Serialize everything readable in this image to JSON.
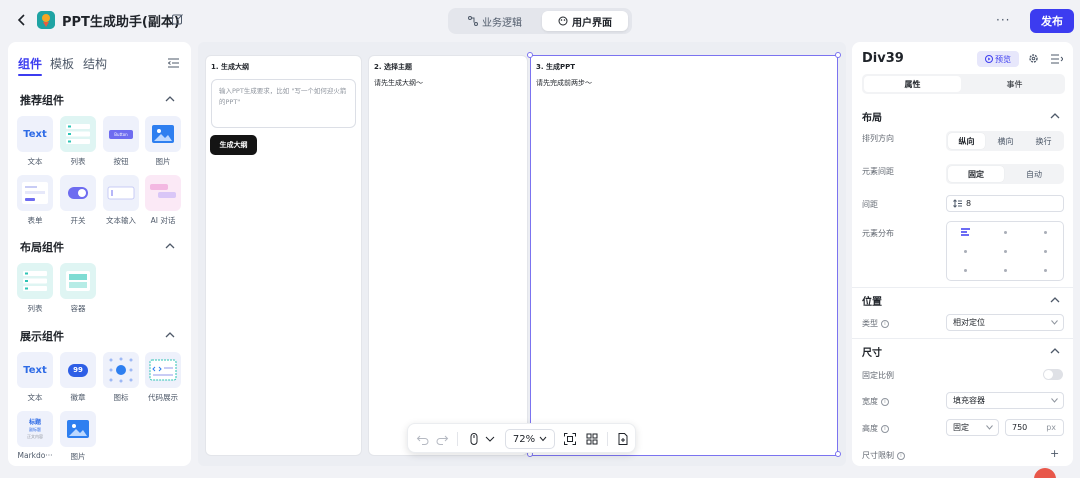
{
  "header": {
    "app_title": "PPT生成助手(副本)",
    "tabs": [
      {
        "label": "业务逻辑"
      },
      {
        "label": "用户界面"
      }
    ],
    "more": "···",
    "publish": "发布"
  },
  "left_panel": {
    "tabs": [
      "组件",
      "模板",
      "结构"
    ],
    "sections": [
      {
        "title": "推荐组件",
        "items": [
          "文本",
          "列表",
          "按钮",
          "图片",
          "表单",
          "开关",
          "文本输入",
          "AI 对话"
        ]
      },
      {
        "title": "布局组件",
        "items": [
          "列表",
          "容器"
        ]
      },
      {
        "title": "展示组件",
        "items": [
          "文本",
          "徽章",
          "图标",
          "代码展示",
          "Markdo···",
          "图片"
        ]
      }
    ],
    "tile_text": "Text",
    "badge_num": "99",
    "md_tile": [
      "标题",
      "副标题",
      "正文内容"
    ],
    "button_tile_text": "Button"
  },
  "canvas": {
    "col1": {
      "title": "1. 生成大纲",
      "placeholder": "输入PPT生成要求，比如 \"写一个如何迎火箭的PPT\"",
      "button": "生成大纲"
    },
    "col2": {
      "title": "2. 选择主题",
      "hint": "请先生成大纲～"
    },
    "col3": {
      "title": "3. 生成PPT",
      "hint": "请先完成前两步～"
    }
  },
  "toolbar": {
    "zoom": "72%"
  },
  "right_panel": {
    "title": "Div39",
    "preview": "预览",
    "tabs": [
      "属性",
      "事件"
    ],
    "layout": {
      "title": "布局",
      "direction_label": "排列方向",
      "direction_options": [
        "纵向",
        "横向",
        "换行"
      ],
      "spacing_label": "元素间距",
      "spacing_options": [
        "固定",
        "自动"
      ],
      "gap_label": "间距",
      "gap_value": "8",
      "distribution_label": "元素分布"
    },
    "position": {
      "title": "位置",
      "type_label": "类型",
      "type_value": "相对定位"
    },
    "size": {
      "title": "尺寸",
      "ratio_label": "固定比例",
      "width_label": "宽度",
      "width_value": "填充容器",
      "height_label": "高度",
      "height_mode": "固定",
      "height_value": "750",
      "height_unit": "px",
      "limit_label": "尺寸限制",
      "add": "+"
    }
  },
  "colors": {
    "accent": "#3c3cf0",
    "selection": "#7b73f0",
    "dark_button": "#141414"
  }
}
